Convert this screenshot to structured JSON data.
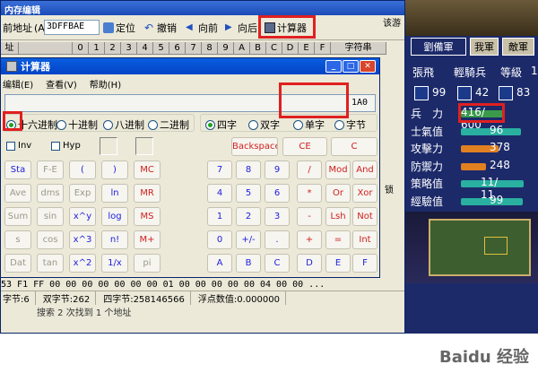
{
  "mem": {
    "title": "内存编辑",
    "addr_label": "前地址",
    "addr_hotkey": "(A)",
    "addr_value": "3DFFBAE",
    "toolbar": [
      "定位",
      "撤销",
      "向前",
      "向后",
      "计算器"
    ],
    "hex_header": [
      "址",
      "0",
      "1",
      "2",
      "3",
      "4",
      "5",
      "6",
      "7",
      "8",
      "9",
      "A",
      "B",
      "C",
      "D",
      "E",
      "F",
      "字符串"
    ],
    "hex_row": "53 F1 FF 00 00 00 00 00 00 00 01 00 00 00 00 00 04 00 00 ...",
    "status": {
      "byte": "字节:6",
      "word": "双字节:262",
      "dword": "四字节:258146566",
      "float": "浮点数值:0.000000"
    },
    "search": "搜索 2 次找到 1 个地址",
    "side_text": "该游",
    "side_text2": "锁"
  },
  "calc": {
    "title": "计算器",
    "menu": [
      "编辑(E)",
      "查看(V)",
      "帮助(H)"
    ],
    "display": "1A0",
    "bases": [
      "十六进制",
      "十进制",
      "八进制",
      "二进制"
    ],
    "sizes": [
      "四字",
      "双字",
      "单字",
      "字节"
    ],
    "inv": "Inv",
    "hyp": "Hyp",
    "backspace": "Backspace",
    "ce": "CE",
    "c": "C",
    "left_rows": [
      [
        "Sta",
        "F-E",
        "(",
        ")",
        "MC"
      ],
      [
        "Ave",
        "dms",
        "Exp",
        "ln",
        "MR"
      ],
      [
        "Sum",
        "sin",
        "x^y",
        "log",
        "MS"
      ],
      [
        "s",
        "cos",
        "x^3",
        "n!",
        "M+"
      ],
      [
        "Dat",
        "tan",
        "x^2",
        "1/x",
        "pi"
      ]
    ],
    "right_rows": [
      [
        "7",
        "8",
        "9",
        "/",
        "Mod",
        "And"
      ],
      [
        "4",
        "5",
        "6",
        "*",
        "Or",
        "Xor"
      ],
      [
        "1",
        "2",
        "3",
        "-",
        "Lsh",
        "Not"
      ],
      [
        "0",
        "+/-",
        ".",
        "+",
        "=",
        "Int"
      ],
      [
        "A",
        "B",
        "C",
        "D",
        "E",
        "F"
      ]
    ]
  },
  "game": {
    "tabs": [
      "劉備軍",
      "我軍",
      "敵軍"
    ],
    "name": "張飛",
    "unit": "輕騎兵",
    "level_label": "等級",
    "level": "1",
    "stat_icons": [
      "99",
      "42",
      "83"
    ],
    "stats": [
      {
        "label": "兵　力",
        "value": "416/ 600"
      },
      {
        "label": "士氣值",
        "value": "96"
      },
      {
        "label": "攻擊力",
        "value": "378"
      },
      {
        "label": "防禦力",
        "value": "248"
      },
      {
        "label": "策略值",
        "value": "11/ 11"
      },
      {
        "label": "經驗值",
        "value": "99"
      }
    ]
  },
  "watermark": "Baidu 经验"
}
